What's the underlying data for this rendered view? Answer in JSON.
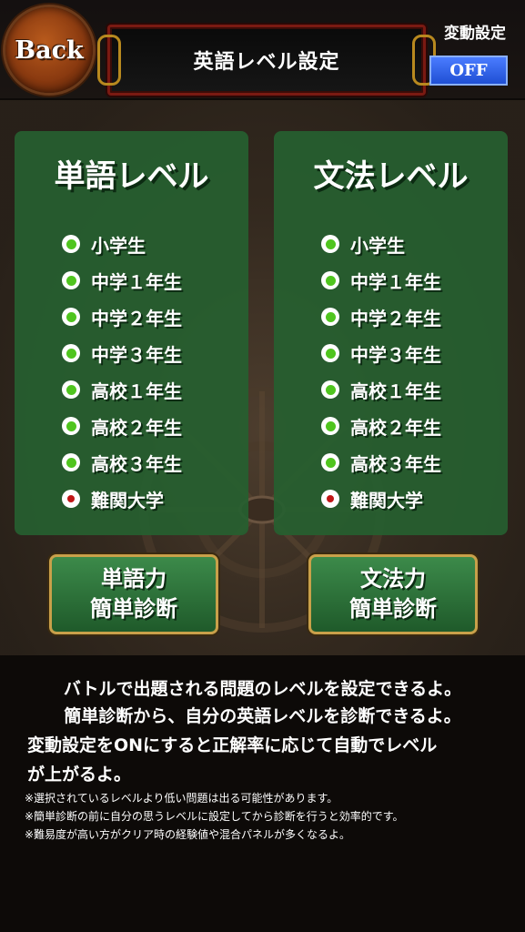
{
  "header": {
    "back_label": "Back",
    "title": "英語レベル設定",
    "hendo_label": "変動設定",
    "hendo_value": "OFF"
  },
  "word_panel": {
    "title": "単語レベル",
    "levels": [
      "小学生",
      "中学１年生",
      "中学２年生",
      "中学３年生",
      "高校１年生",
      "高校２年生",
      "高校３年生",
      "難関大学"
    ],
    "selected": "難関大学"
  },
  "grammar_panel": {
    "title": "文法レベル",
    "levels": [
      "小学生",
      "中学１年生",
      "中学２年生",
      "中学３年生",
      "高校１年生",
      "高校２年生",
      "高校３年生",
      "難関大学"
    ],
    "selected": "難関大学"
  },
  "buttons": {
    "word_diag_line1": "単語力",
    "word_diag_line2": "簡単診断",
    "grammar_diag_line1": "文法力",
    "grammar_diag_line2": "簡単診断"
  },
  "info": {
    "line1": "バトルで出題される問題のレベルを設定できるよ。",
    "line2": "簡単診断から、自分の英語レベルを診断できるよ。",
    "line3": "変動設定をONにすると正解率に応じて自動でレベル",
    "line4": "が上がるよ。",
    "note1": "※選択されているレベルより低い問題は出る可能性があります。",
    "note2": "※簡単診断の前に自分の思うレベルに設定してから診断を行うと効率的です。",
    "note3": "※難易度が高い方がクリア時の経験値や混合パネルが多くなるよ。"
  },
  "colors": {
    "panel_green": "#266030",
    "radio_on": "#4fc51e",
    "radio_selected": "#c01616",
    "toggle_blue": "#1f4fd4"
  }
}
